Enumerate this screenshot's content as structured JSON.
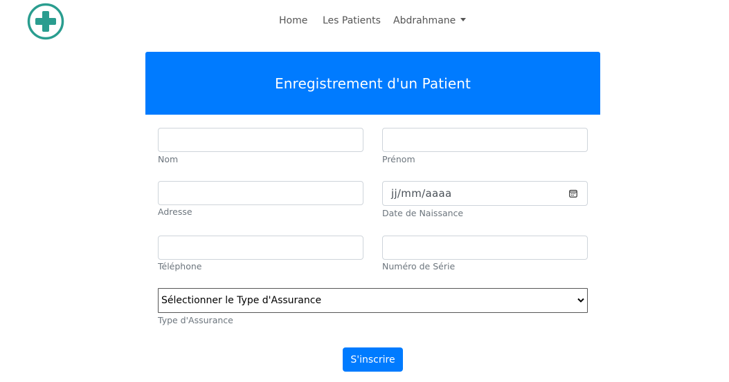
{
  "colors": {
    "brand_teal": "#2a9d8f",
    "primary": "#007bff",
    "nav_text": "#555555",
    "label_text": "#6c757d"
  },
  "logo": {
    "icon": "medical-cross-icon"
  },
  "nav": {
    "home": "Home",
    "patients": "Les Patients",
    "user": "Abdrahmane"
  },
  "form": {
    "title": "Enregistrement d'un Patient",
    "fields": {
      "nom": {
        "label": "Nom",
        "value": ""
      },
      "prenom": {
        "label": "Prénom",
        "value": ""
      },
      "adresse": {
        "label": "Adresse",
        "value": ""
      },
      "date_naissance": {
        "label": "Date de Naissance",
        "placeholder": "jj/mm/aaaa",
        "icon": "calendar-icon"
      },
      "telephone": {
        "label": "Téléphone",
        "value": ""
      },
      "numero_serie": {
        "label": "Numéro de Série",
        "value": ""
      },
      "assurance": {
        "label": "Type d'Assurance",
        "selected": "Sélectionner le Type d'Assurance",
        "icon": "chevron-down-icon"
      }
    },
    "submit_label": "S'inscrire"
  }
}
